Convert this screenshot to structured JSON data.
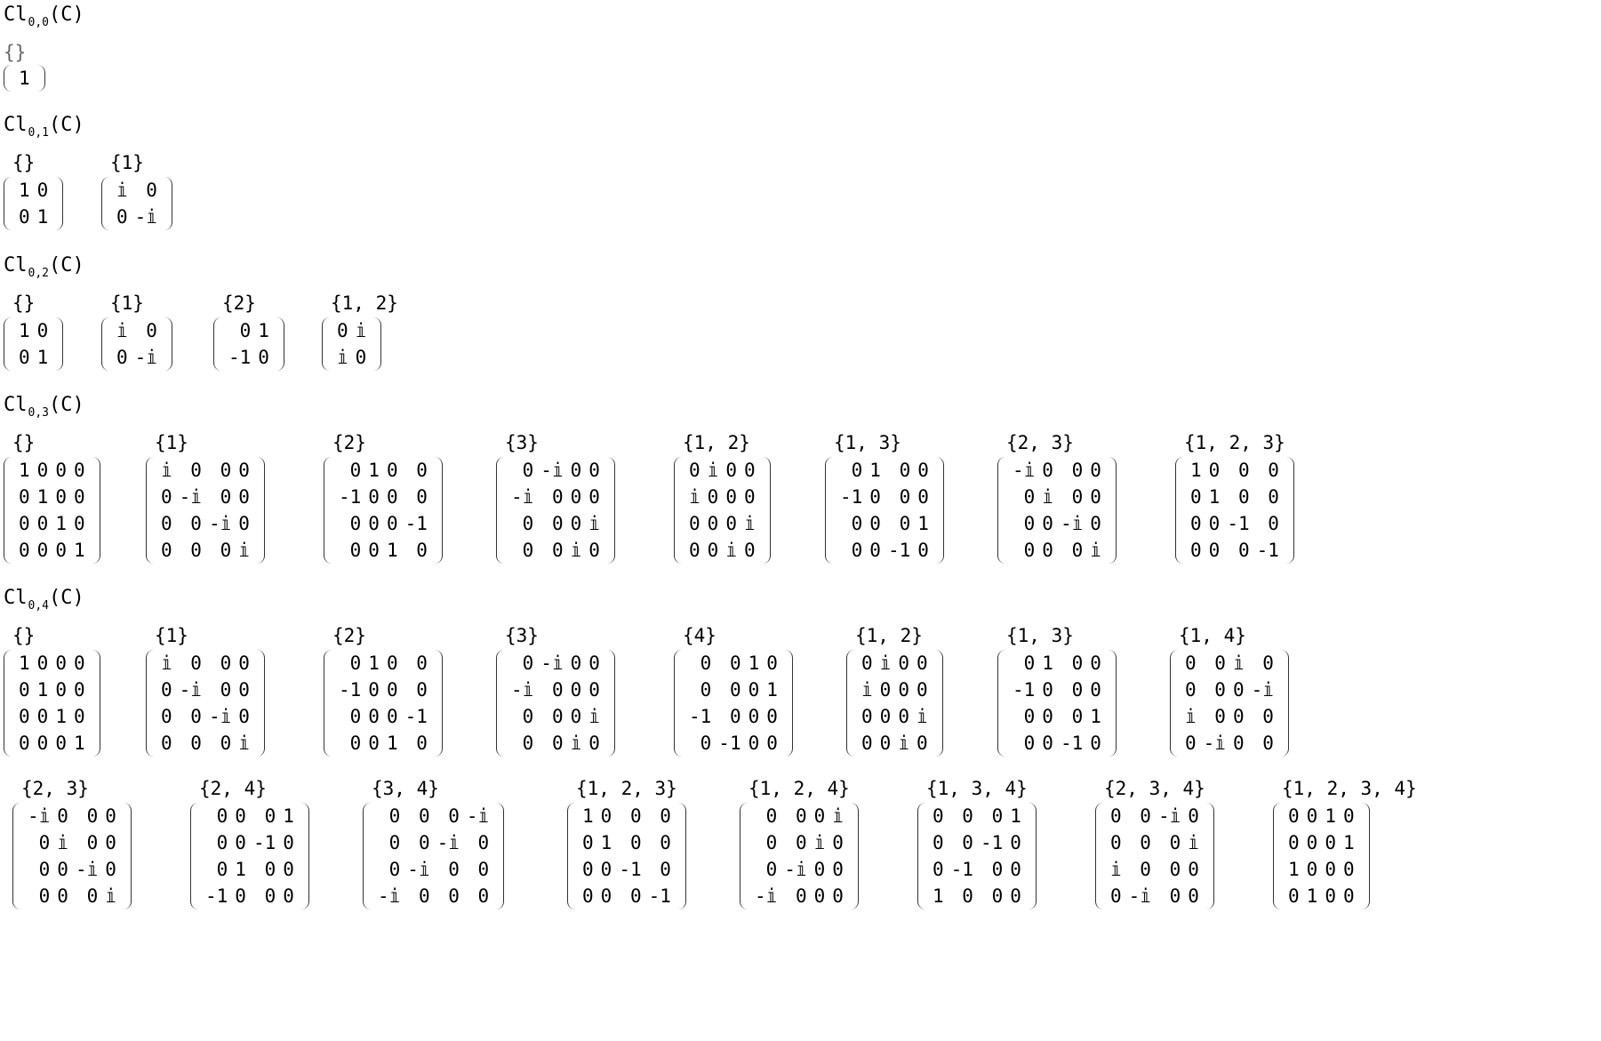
{
  "sections": [
    {
      "title_main": "Cl",
      "title_sub": "0,0",
      "title_tail": "(C)",
      "rows": [
        [
          {
            "label": "{}",
            "matrix": [
              [
                "1"
              ]
            ]
          }
        ]
      ]
    },
    {
      "title_main": "Cl",
      "title_sub": "0,1",
      "title_tail": "(C)",
      "rows": [
        [
          {
            "label": "{}",
            "matrix": [
              [
                "1",
                "0"
              ],
              [
                "0",
                "1"
              ]
            ]
          },
          {
            "label": "{1}",
            "matrix": [
              [
                "𝕚",
                "0"
              ],
              [
                "0",
                "-𝕚"
              ]
            ]
          }
        ]
      ]
    },
    {
      "title_main": "Cl",
      "title_sub": "0,2",
      "title_tail": "(C)",
      "rows": [
        [
          {
            "label": "{}",
            "matrix": [
              [
                "1",
                "0"
              ],
              [
                "0",
                "1"
              ]
            ]
          },
          {
            "label": "{1}",
            "matrix": [
              [
                "𝕚",
                "0"
              ],
              [
                "0",
                "-𝕚"
              ]
            ]
          },
          {
            "label": "{2}",
            "matrix": [
              [
                "0",
                "1"
              ],
              [
                "-1",
                "0"
              ]
            ]
          },
          {
            "label": "{1, 2}",
            "matrix": [
              [
                "0",
                "𝕚"
              ],
              [
                "𝕚",
                "0"
              ]
            ]
          }
        ]
      ]
    },
    {
      "title_main": "Cl",
      "title_sub": "0,3",
      "title_tail": "(C)",
      "rows": [
        [
          {
            "label": "{}",
            "matrix": [
              [
                "1",
                "0",
                "0",
                "0"
              ],
              [
                "0",
                "1",
                "0",
                "0"
              ],
              [
                "0",
                "0",
                "1",
                "0"
              ],
              [
                "0",
                "0",
                "0",
                "1"
              ]
            ]
          },
          {
            "label": "{1}",
            "matrix": [
              [
                "𝕚",
                "0",
                "0",
                "0"
              ],
              [
                "0",
                "-𝕚",
                "0",
                "0"
              ],
              [
                "0",
                "0",
                "-𝕚",
                "0"
              ],
              [
                "0",
                "0",
                "0",
                "𝕚"
              ]
            ]
          },
          {
            "label": "{2}",
            "matrix": [
              [
                "0",
                "1",
                "0",
                "0"
              ],
              [
                "-1",
                "0",
                "0",
                "0"
              ],
              [
                "0",
                "0",
                "0",
                "-1"
              ],
              [
                "0",
                "0",
                "1",
                "0"
              ]
            ]
          },
          {
            "label": "{3}",
            "matrix": [
              [
                "0",
                "-𝕚",
                "0",
                "0"
              ],
              [
                "-𝕚",
                "0",
                "0",
                "0"
              ],
              [
                "0",
                "0",
                "0",
                "𝕚"
              ],
              [
                "0",
                "0",
                "𝕚",
                "0"
              ]
            ]
          },
          {
            "label": "{1, 2}",
            "matrix": [
              [
                "0",
                "𝕚",
                "0",
                "0"
              ],
              [
                "𝕚",
                "0",
                "0",
                "0"
              ],
              [
                "0",
                "0",
                "0",
                "𝕚"
              ],
              [
                "0",
                "0",
                "𝕚",
                "0"
              ]
            ]
          },
          {
            "label": "{1, 3}",
            "matrix": [
              [
                "0",
                "1",
                "0",
                "0"
              ],
              [
                "-1",
                "0",
                "0",
                "0"
              ],
              [
                "0",
                "0",
                "0",
                "1"
              ],
              [
                "0",
                "0",
                "-1",
                "0"
              ]
            ]
          },
          {
            "label": "{2, 3}",
            "matrix": [
              [
                "-𝕚",
                "0",
                "0",
                "0"
              ],
              [
                "0",
                "𝕚",
                "0",
                "0"
              ],
              [
                "0",
                "0",
                "-𝕚",
                "0"
              ],
              [
                "0",
                "0",
                "0",
                "𝕚"
              ]
            ]
          },
          {
            "label": "{1, 2, 3}",
            "matrix": [
              [
                "1",
                "0",
                "0",
                "0"
              ],
              [
                "0",
                "1",
                "0",
                "0"
              ],
              [
                "0",
                "0",
                "-1",
                "0"
              ],
              [
                "0",
                "0",
                "0",
                "-1"
              ]
            ]
          }
        ]
      ]
    },
    {
      "title_main": "Cl",
      "title_sub": "0,4",
      "title_tail": "(C)",
      "rows": [
        [
          {
            "label": "{}",
            "matrix": [
              [
                "1",
                "0",
                "0",
                "0"
              ],
              [
                "0",
                "1",
                "0",
                "0"
              ],
              [
                "0",
                "0",
                "1",
                "0"
              ],
              [
                "0",
                "0",
                "0",
                "1"
              ]
            ]
          },
          {
            "label": "{1}",
            "matrix": [
              [
                "𝕚",
                "0",
                "0",
                "0"
              ],
              [
                "0",
                "-𝕚",
                "0",
                "0"
              ],
              [
                "0",
                "0",
                "-𝕚",
                "0"
              ],
              [
                "0",
                "0",
                "0",
                "𝕚"
              ]
            ]
          },
          {
            "label": "{2}",
            "matrix": [
              [
                "0",
                "1",
                "0",
                "0"
              ],
              [
                "-1",
                "0",
                "0",
                "0"
              ],
              [
                "0",
                "0",
                "0",
                "-1"
              ],
              [
                "0",
                "0",
                "1",
                "0"
              ]
            ]
          },
          {
            "label": "{3}",
            "matrix": [
              [
                "0",
                "-𝕚",
                "0",
                "0"
              ],
              [
                "-𝕚",
                "0",
                "0",
                "0"
              ],
              [
                "0",
                "0",
                "0",
                "𝕚"
              ],
              [
                "0",
                "0",
                "𝕚",
                "0"
              ]
            ]
          },
          {
            "label": "{4}",
            "matrix": [
              [
                "0",
                "0",
                "1",
                "0"
              ],
              [
                "0",
                "0",
                "0",
                "1"
              ],
              [
                "-1",
                "0",
                "0",
                "0"
              ],
              [
                "0",
                "-1",
                "0",
                "0"
              ]
            ]
          },
          {
            "label": "{1, 2}",
            "matrix": [
              [
                "0",
                "𝕚",
                "0",
                "0"
              ],
              [
                "𝕚",
                "0",
                "0",
                "0"
              ],
              [
                "0",
                "0",
                "0",
                "𝕚"
              ],
              [
                "0",
                "0",
                "𝕚",
                "0"
              ]
            ]
          },
          {
            "label": "{1, 3}",
            "matrix": [
              [
                "0",
                "1",
                "0",
                "0"
              ],
              [
                "-1",
                "0",
                "0",
                "0"
              ],
              [
                "0",
                "0",
                "0",
                "1"
              ],
              [
                "0",
                "0",
                "-1",
                "0"
              ]
            ]
          },
          {
            "label": "{1, 4}",
            "matrix": [
              [
                "0",
                "0",
                "𝕚",
                "0"
              ],
              [
                "0",
                "0",
                "0",
                "-𝕚"
              ],
              [
                "𝕚",
                "0",
                "0",
                "0"
              ],
              [
                "0",
                "-𝕚",
                "0",
                "0"
              ]
            ]
          }
        ],
        [
          {
            "label": "{2, 3}",
            "matrix": [
              [
                "-𝕚",
                "0",
                "0",
                "0"
              ],
              [
                "0",
                "𝕚",
                "0",
                "0"
              ],
              [
                "0",
                "0",
                "-𝕚",
                "0"
              ],
              [
                "0",
                "0",
                "0",
                "𝕚"
              ]
            ]
          },
          {
            "label": "{2, 4}",
            "matrix": [
              [
                "0",
                "0",
                "0",
                "1"
              ],
              [
                "0",
                "0",
                "-1",
                "0"
              ],
              [
                "0",
                "1",
                "0",
                "0"
              ],
              [
                "-1",
                "0",
                "0",
                "0"
              ]
            ]
          },
          {
            "label": "{3, 4}",
            "matrix": [
              [
                "0",
                "0",
                "0",
                "-𝕚"
              ],
              [
                "0",
                "0",
                "-𝕚",
                "0"
              ],
              [
                "0",
                "-𝕚",
                "0",
                "0"
              ],
              [
                "-𝕚",
                "0",
                "0",
                "0"
              ]
            ]
          },
          {
            "label": "{1, 2, 3}",
            "matrix": [
              [
                "1",
                "0",
                "0",
                "0"
              ],
              [
                "0",
                "1",
                "0",
                "0"
              ],
              [
                "0",
                "0",
                "-1",
                "0"
              ],
              [
                "0",
                "0",
                "0",
                "-1"
              ]
            ]
          },
          {
            "label": "{1, 2, 4}",
            "matrix": [
              [
                "0",
                "0",
                "0",
                "𝕚"
              ],
              [
                "0",
                "0",
                "𝕚",
                "0"
              ],
              [
                "0",
                "-𝕚",
                "0",
                "0"
              ],
              [
                "-𝕚",
                "0",
                "0",
                "0"
              ]
            ]
          },
          {
            "label": "{1, 3, 4}",
            "matrix": [
              [
                "0",
                "0",
                "0",
                "1"
              ],
              [
                "0",
                "0",
                "-1",
                "0"
              ],
              [
                "0",
                "-1",
                "0",
                "0"
              ],
              [
                "1",
                "0",
                "0",
                "0"
              ]
            ]
          },
          {
            "label": "{2, 3, 4}",
            "matrix": [
              [
                "0",
                "0",
                "-𝕚",
                "0"
              ],
              [
                "0",
                "0",
                "0",
                "𝕚"
              ],
              [
                "𝕚",
                "0",
                "0",
                "0"
              ],
              [
                "0",
                "-𝕚",
                "0",
                "0"
              ]
            ]
          },
          {
            "label": "{1, 2, 3, 4}",
            "matrix": [
              [
                "0",
                "0",
                "1",
                "0"
              ],
              [
                "0",
                "0",
                "0",
                "1"
              ],
              [
                "1",
                "0",
                "0",
                "0"
              ],
              [
                "0",
                "1",
                "0",
                "0"
              ]
            ]
          }
        ]
      ]
    }
  ]
}
